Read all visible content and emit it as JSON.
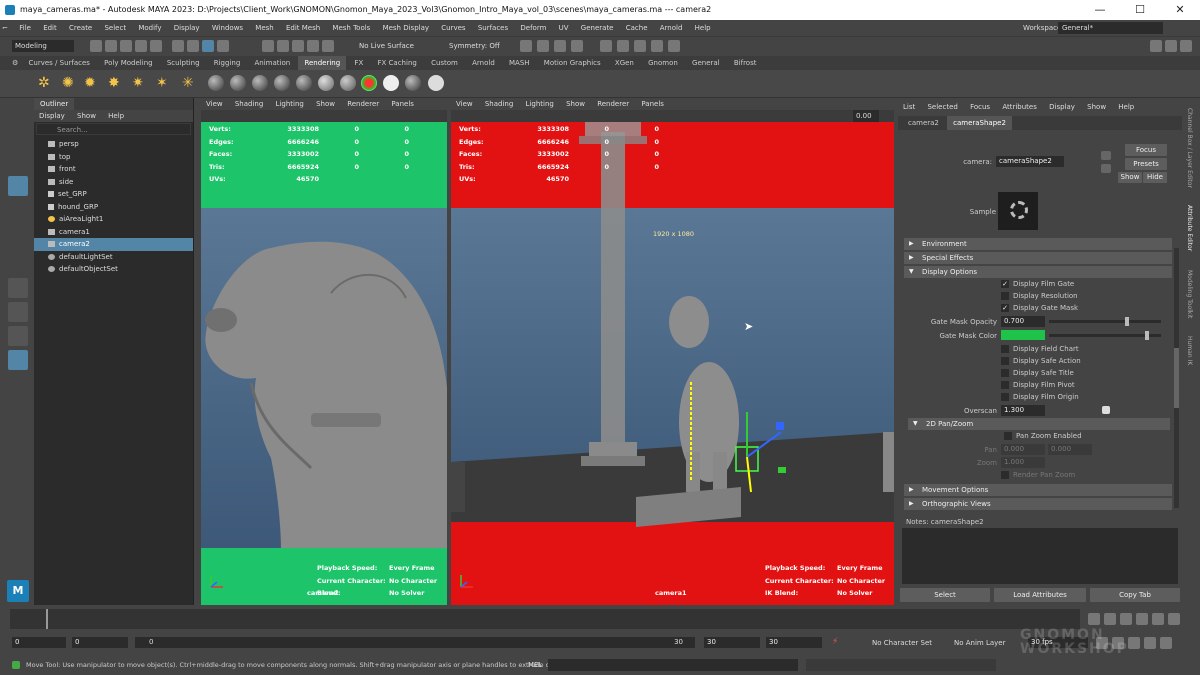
{
  "window": {
    "title": "maya_cameras.ma* - Autodesk MAYA 2023: D:\\Projects\\Client_Work\\GNOMON\\Gnomon_Maya_2023_Vol3\\Gnomon_Intro_Maya_vol_03\\scenes\\maya_cameras.ma   ---   camera2",
    "minimize": "—",
    "maximize": "☐",
    "close": "✕"
  },
  "menus": [
    "File",
    "Edit",
    "Create",
    "Select",
    "Modify",
    "Display",
    "Windows",
    "Mesh",
    "Edit Mesh",
    "Mesh Tools",
    "Mesh Display",
    "Curves",
    "Surfaces",
    "Deform",
    "UV",
    "Generate",
    "Cache",
    "Arnold",
    "Help"
  ],
  "statusline": {
    "mode": "Modeling",
    "live_surface": "No Live Surface",
    "symmetry": "Symmetry: Off",
    "workspace_label": "Workspace:",
    "workspace_value": "General*"
  },
  "shelf_tabs": [
    "Curves / Surfaces",
    "Poly Modeling",
    "Sculpting",
    "Rigging",
    "Animation",
    "Rendering",
    "FX",
    "FX Caching",
    "Custom",
    "Arnold",
    "MASH",
    "Motion Graphics",
    "XGen",
    "Gnomon",
    "General",
    "Bifrost"
  ],
  "shelf_active": "Rendering",
  "outliner": {
    "tab": "Outliner",
    "menu": [
      "Display",
      "Show",
      "Help"
    ],
    "search_placeholder": "Search...",
    "items": [
      {
        "label": "persp",
        "icon": "camera-icon",
        "selected": false
      },
      {
        "label": "top",
        "icon": "camera-icon",
        "selected": false
      },
      {
        "label": "front",
        "icon": "camera-icon",
        "selected": false
      },
      {
        "label": "side",
        "icon": "camera-icon",
        "selected": false
      },
      {
        "label": "set_GRP",
        "icon": "group-icon",
        "selected": false
      },
      {
        "label": "hound_GRP",
        "icon": "group-icon",
        "selected": false
      },
      {
        "label": "aiAreaLight1",
        "icon": "light-icon",
        "selected": false
      },
      {
        "label": "camera1",
        "icon": "camera-icon",
        "selected": false
      },
      {
        "label": "camera2",
        "icon": "camera-icon",
        "selected": true
      },
      {
        "label": "defaultLightSet",
        "icon": "set-icon",
        "selected": false
      },
      {
        "label": "defaultObjectSet",
        "icon": "set-icon",
        "selected": false
      }
    ]
  },
  "viewport_menu": [
    "View",
    "Shading",
    "Lighting",
    "Show",
    "Renderer",
    "Panels"
  ],
  "hud_stats": [
    {
      "k": "Verts:",
      "a": "3333308",
      "b": "0",
      "c": "0"
    },
    {
      "k": "Edges:",
      "a": "6666246",
      "b": "0",
      "c": "0"
    },
    {
      "k": "Faces:",
      "a": "3333002",
      "b": "0",
      "c": "0"
    },
    {
      "k": "Tris:",
      "a": "6665924",
      "b": "0",
      "c": "0"
    },
    {
      "k": "UVs:",
      "a": "46570",
      "b": "0",
      "c": "0"
    }
  ],
  "hud_bottom": [
    {
      "k": "Playback Speed:",
      "v": "Every Frame"
    },
    {
      "k": "Current Character:",
      "v": "No Character"
    },
    {
      "k": "IK Blend:",
      "v": "No Solver"
    }
  ],
  "left_vp": {
    "camera": "camera2",
    "hud_k3": "Blend:"
  },
  "right_vp": {
    "camera": "camera1",
    "resolution": "1920 x 1080",
    "value": "0.00"
  },
  "attr": {
    "menu": [
      "List",
      "Selected",
      "Focus",
      "Attributes",
      "Display",
      "Show",
      "Help"
    ],
    "tabs": [
      "camera2",
      "cameraShape2"
    ],
    "camera_label": "camera:",
    "camera_value": "cameraShape2",
    "focus": "Focus",
    "presets": "Presets",
    "show": "Show",
    "hide": "Hide",
    "sample": "Sample",
    "sections": [
      "Environment",
      "Special Effects",
      "Display Options",
      "2D Pan/Zoom",
      "Movement Options",
      "Orthographic Views"
    ],
    "display_options": [
      {
        "label": "Display Film Gate",
        "checked": true
      },
      {
        "label": "Display Resolution",
        "checked": false
      },
      {
        "label": "Display Gate Mask",
        "checked": true
      }
    ],
    "gate_mask_opacity_label": "Gate Mask Opacity",
    "gate_mask_opacity": "0.700",
    "gate_mask_color_label": "Gate Mask Color",
    "gate_mask_color": "#1ec44a",
    "display_options2": [
      {
        "label": "Display Field Chart",
        "checked": false
      },
      {
        "label": "Display Safe Action",
        "checked": false
      },
      {
        "label": "Display Safe Title",
        "checked": false
      },
      {
        "label": "Display Film Pivot",
        "checked": false
      },
      {
        "label": "Display Film Origin",
        "checked": false
      }
    ],
    "overscan_label": "Overscan",
    "overscan": "1.300",
    "pan_zoom_enable": "Pan Zoom Enabled",
    "pan_label": "Pan",
    "pan_x": "0.000",
    "pan_y": "0.000",
    "zoom_label": "Zoom",
    "zoom": "1.000",
    "render_pan_zoom": "Render Pan Zoom",
    "notes_label": "Notes:  cameraShape2",
    "btn_select": "Select",
    "btn_load": "Load Attributes",
    "btn_copy": "Copy Tab"
  },
  "side_tabs": [
    "Channel Box / Layer Editor",
    "Attribute Editor",
    "Modeling Toolkit",
    "Human IK"
  ],
  "time": {
    "start": "0",
    "start2": "0",
    "range_start": "0",
    "range_end": "30",
    "end1": "30",
    "end2": "30",
    "character": "No Character Set",
    "anim_layer": "No Anim Layer",
    "fps": "30 fps"
  },
  "help_text": "Move Tool: Use manipulator to move object(s). Ctrl+middle-drag to move components along normals. Shift+drag manipulator axis or plane handles to extrude components or",
  "mel": "MEL",
  "watermark": "GNOMON WORKSHOP",
  "colors": {
    "green_mask": "#1ec46a",
    "red_mask": "#e31212",
    "selection": "#5285a6"
  }
}
